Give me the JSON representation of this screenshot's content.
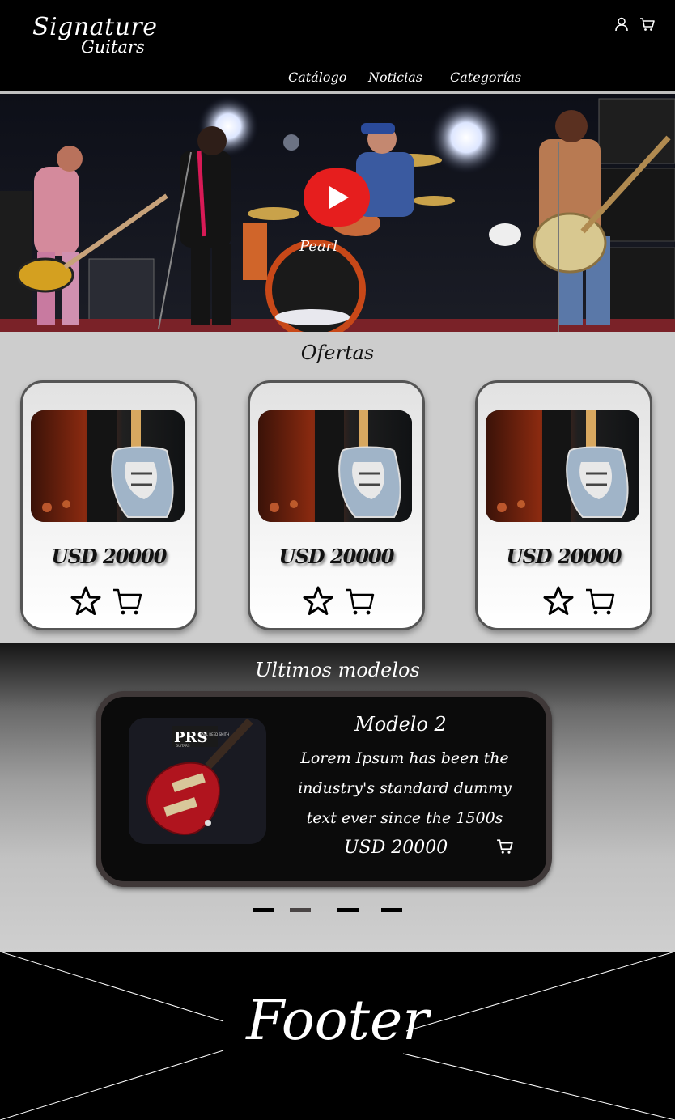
{
  "header": {
    "logo_line1": "Signature",
    "logo_line2": "Guitars",
    "user_icon": "user-icon",
    "cart_icon": "cart-icon",
    "nav": [
      "Catálogo",
      "Noticias",
      "Categorías"
    ]
  },
  "hero": {
    "play_icon": "play-icon"
  },
  "ofertas": {
    "title": "Ofertas",
    "cards": [
      {
        "price": "USD 20000",
        "favorite_icon": "star-icon",
        "cart_icon": "cart-icon"
      },
      {
        "price": "USD 20000",
        "favorite_icon": "star-icon",
        "cart_icon": "cart-icon"
      },
      {
        "price": "USD 20000",
        "favorite_icon": "star-icon",
        "cart_icon": "cart-icon"
      }
    ]
  },
  "ultimos": {
    "title": "Ultimos modelos",
    "slide": {
      "brand_text": "PRS",
      "brand_sub": "PAUL REED SMITH",
      "brand_sub2": "GUITARS",
      "name": "Modelo 2",
      "description": "Lorem Ipsum has been the industry's standard dummy text ever since the 1500s",
      "price": "USD 20000",
      "cart_icon": "cart-icon"
    },
    "dots": 4,
    "active_dot": 1
  },
  "footer": {
    "text": "Footer"
  },
  "colors": {
    "header_bg": "#000000",
    "ofertas_bg": "#cdcdcd",
    "play_red": "#e61e1e",
    "slide_bg": "#0b0b0b"
  }
}
